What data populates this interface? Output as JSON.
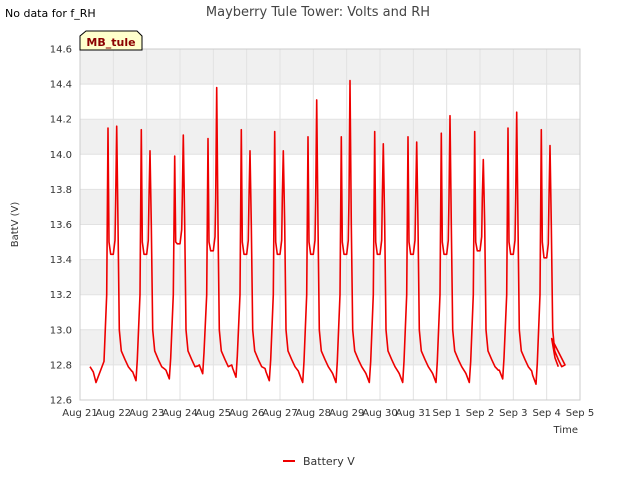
{
  "no_data_note": "No data for f_RH",
  "chart_data": {
    "type": "line",
    "title": "Mayberry Tule Tower: Volts and RH",
    "xlabel": "Time",
    "ylabel": "BattV (V)",
    "badge": "MB_tule",
    "x_tick_labels": [
      "Aug 21",
      "Aug 22",
      "Aug 23",
      "Aug 24",
      "Aug 25",
      "Aug 26",
      "Aug 27",
      "Aug 28",
      "Aug 29",
      "Aug 30",
      "Aug 31",
      "Sep 1",
      "Sep 2",
      "Sep 3",
      "Sep 4",
      "Sep 5"
    ],
    "xlim_days": [
      0,
      15
    ],
    "ylim": [
      12.6,
      14.6
    ],
    "y_ticks": [
      12.6,
      12.8,
      13.0,
      13.2,
      13.4,
      13.6,
      13.8,
      14.0,
      14.2,
      14.4,
      14.6
    ],
    "grid": true,
    "legend_position": "bottom-center",
    "series": [
      {
        "name": "Battery V",
        "color": "#ee0000",
        "days": [
          {
            "start": 0.3,
            "min": 12.7,
            "peak1": 14.15,
            "plateau": 13.43,
            "peak2": 14.16
          },
          {
            "start": 1.0,
            "min": 12.71,
            "peak1": 14.14,
            "plateau": 13.43,
            "peak2": 14.02
          },
          {
            "start": 2.0,
            "min": 12.72,
            "peak1": 13.99,
            "plateau": 13.49,
            "peak2": 14.11
          },
          {
            "start": 3.0,
            "min": 12.75,
            "peak1": 14.09,
            "plateau": 13.45,
            "peak2": 14.38
          },
          {
            "start": 4.0,
            "min": 12.73,
            "peak1": 14.14,
            "plateau": 13.43,
            "peak2": 14.02
          },
          {
            "start": 5.0,
            "min": 12.71,
            "peak1": 14.13,
            "plateau": 13.43,
            "peak2": 14.02
          },
          {
            "start": 6.0,
            "min": 12.7,
            "peak1": 14.1,
            "plateau": 13.43,
            "peak2": 14.31
          },
          {
            "start": 7.0,
            "min": 12.7,
            "peak1": 14.1,
            "plateau": 13.43,
            "peak2": 14.42
          },
          {
            "start": 8.0,
            "min": 12.7,
            "peak1": 14.13,
            "plateau": 13.43,
            "peak2": 14.06
          },
          {
            "start": 9.0,
            "min": 12.7,
            "peak1": 14.1,
            "plateau": 13.43,
            "peak2": 14.07
          },
          {
            "start": 10.0,
            "min": 12.7,
            "peak1": 14.12,
            "plateau": 13.43,
            "peak2": 14.22
          },
          {
            "start": 11.0,
            "min": 12.7,
            "peak1": 14.13,
            "plateau": 13.45,
            "peak2": 13.97
          },
          {
            "start": 12.0,
            "min": 12.72,
            "peak1": 14.15,
            "plateau": 13.43,
            "peak2": 14.24
          },
          {
            "start": 13.0,
            "min": 12.69,
            "peak1": 14.14,
            "plateau": 13.41,
            "peak2": 14.05
          }
        ],
        "end_day": 14.35,
        "end_value": 12.79
      }
    ]
  }
}
